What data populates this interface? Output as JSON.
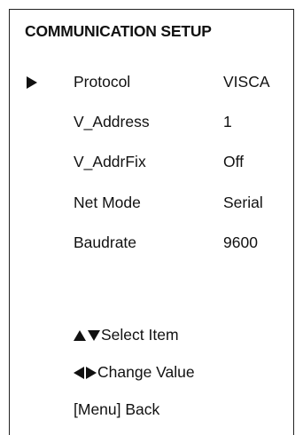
{
  "menu": {
    "title": "COMMUNICATION SETUP",
    "items": [
      {
        "label": "Protocol",
        "value": "VISCA",
        "selected": true
      },
      {
        "label": "V_Address",
        "value": "1",
        "selected": false
      },
      {
        "label": "V_AddrFix",
        "value": "Off",
        "selected": false
      },
      {
        "label": "Net Mode",
        "value": "Serial",
        "selected": false
      },
      {
        "label": "Baudrate",
        "value": "9600",
        "selected": false
      }
    ]
  },
  "hints": {
    "select_item": "Select Item",
    "change_value": "Change Value",
    "back": "[Menu] Back"
  },
  "icons": {
    "cursor": "triangle-right-icon",
    "select": [
      "triangle-up-icon",
      "triangle-down-icon"
    ],
    "change": [
      "triangle-left-icon",
      "triangle-right-icon"
    ]
  },
  "colors": {
    "background": "#ffffff",
    "text": "#111111",
    "border": "#222222"
  }
}
